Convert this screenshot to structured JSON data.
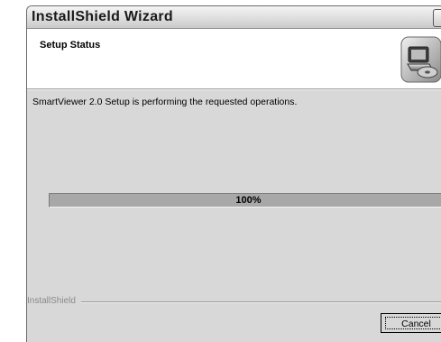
{
  "window": {
    "title": "InstallShield Wizard"
  },
  "header": {
    "title": "Setup Status",
    "icon": "setup-computer-icon"
  },
  "main": {
    "status_message": "SmartViewer 2.0 Setup is performing the requested operations.",
    "progress": {
      "percent": 100,
      "label": "100%"
    }
  },
  "footer": {
    "brand": "InstallShield",
    "cancel_label": "Cancel"
  },
  "colors": {
    "window_bg": "#d8d8d8",
    "header_bg": "#ffffff",
    "progress_fill": "#a8a8a8"
  }
}
